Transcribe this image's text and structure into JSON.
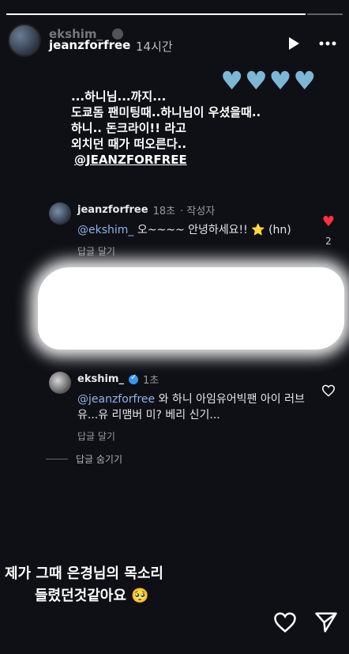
{
  "story": {
    "username_overlay": "ekshim_",
    "username": "jeanzforfree",
    "time": "14시간",
    "hearts": [
      "♥",
      "♥",
      "♥",
      "♥"
    ]
  },
  "caption": {
    "lines": [
      "...하니님...까지...",
      "도쿄돔 팬미팅때..하니님이 우셨을때..",
      "하니.. 돈크라이!! 라고",
      "외치던 때가 떠오른다.."
    ],
    "mention": "@JEANZFORFREE"
  },
  "comments": [
    {
      "username": "jeanzforfree",
      "time": "18초",
      "tag": "· 작성자",
      "mention": "@ekshim_",
      "text": "오~~~~ 안녕하세요!! ⭐ (hn)",
      "reply_label": "답글 달기",
      "likes": "2"
    },
    {
      "username": "ekshim_",
      "time": "1초",
      "mention": "@jeanzforfree",
      "text": "와 하니 아임유어빅팬 아이 러브유...유 리맴버 미? 베리 신기...",
      "reply_label": "답글 달기"
    }
  ],
  "hide_replies": "답글 숨기기",
  "bottom_caption": {
    "line1": "제가 그때 은경님의 목소리",
    "line2": "들렸던것같아요 🥺"
  },
  "colors": {
    "background": "#0f1016",
    "heart_like": "#ff3040",
    "heart_blue": "#7eb6d6",
    "verified": "#3897f0"
  },
  "icons": [
    "play-icon",
    "more-icon",
    "heart-icon",
    "send-icon"
  ]
}
